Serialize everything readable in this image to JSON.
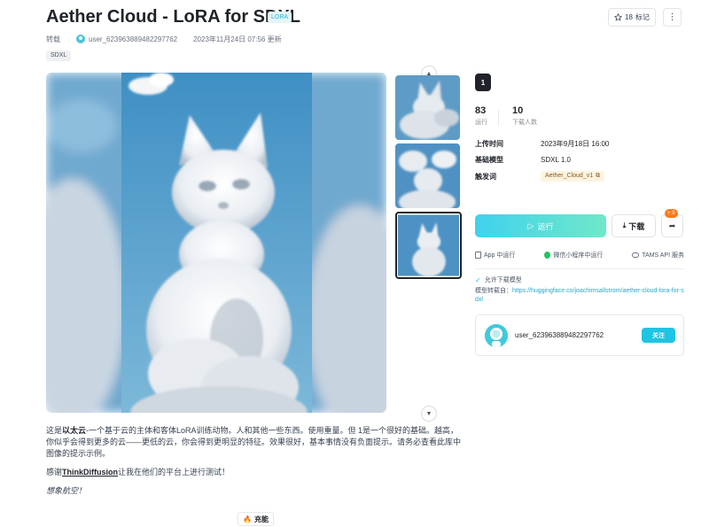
{
  "header": {
    "title": "Aether Cloud - LoRA for SDXL",
    "badge": "LORA",
    "repost_label": "转载",
    "username": "user_623963889482297762",
    "updated": "2023年11月24日 07:56 更新",
    "tag": "SDXL",
    "bookmark_count": "18",
    "bookmark_label": "标记",
    "more_icon": "more-dots-icon"
  },
  "gallery": {
    "thumbnail_count": 3,
    "active_index": 2
  },
  "description": {
    "p1_prefix": "这是",
    "p1_bold": "以太云",
    "p1_rest": "-一个基于云的主体和客体LoRA训练动物。人和其他一些东西。使用重量。但 1是一个很好的基础。越高，你似乎会得到更多的云——更低的云，你会得到更明显的特征。效果很好，基本事情没有负面提示。请务必查看此库中图像的提示示例。",
    "p2_prefix": "感谢",
    "p2_link": "ThinkDiffusion",
    "p2_rest": "让我在他们的平台上进行测试！",
    "p3": "想象航空！",
    "recommend_label": "充能"
  },
  "panel": {
    "version": "1",
    "stats": [
      {
        "value": "83",
        "label": "运行"
      },
      {
        "value": "10",
        "label": "下载人数"
      }
    ],
    "info": {
      "upload_time_label": "上传时间",
      "upload_time": "2023年9月18日 16:00",
      "base_model_label": "基础模型",
      "base_model": "SDXL 1.0",
      "trigger_label": "触发词",
      "trigger_word": "Aether_Cloud_v1"
    },
    "run_label": "运行",
    "download_label": "下载",
    "share_badge": "+ 9",
    "run_options": [
      {
        "label": "App 中运行",
        "icon": "phone-icon"
      },
      {
        "label": "微信小程序中运行",
        "icon": "wechat-icon"
      },
      {
        "label": "TAMS API 服务",
        "icon": "cloud-icon"
      }
    ],
    "allow_download": "允许下载模型",
    "source_label": "模型转载自：",
    "source_url": "https://huggingface.co/joachimsallstrom/aether-cloud-lora-for-sdxl",
    "author": {
      "name": "user_623963889482297762",
      "follow_label": "关注"
    }
  }
}
